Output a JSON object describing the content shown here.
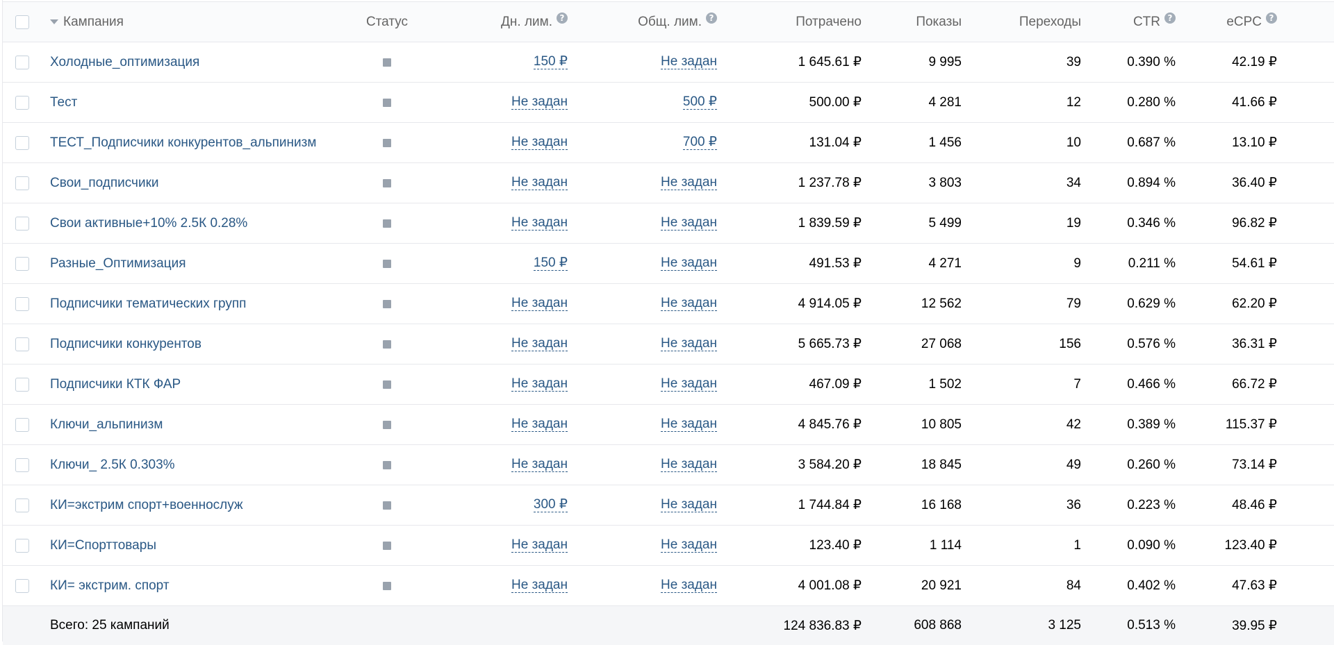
{
  "header": {
    "campaign": "Кампания",
    "status": "Статус",
    "day_limit": "Дн. лим.",
    "total_limit": "Общ. лим.",
    "spent": "Потрачено",
    "shows": "Показы",
    "clicks": "Переходы",
    "ctr": "CTR",
    "ecpc": "eCPC",
    "help_glyph": "?"
  },
  "rows": [
    {
      "name": "Холодные_оптимизация",
      "day": "150 ₽",
      "total": "Не задан",
      "spent": "1 645.61 ₽",
      "shows": "9 995",
      "clicks": "39",
      "ctr": "0.390 %",
      "ecpc": "42.19 ₽"
    },
    {
      "name": "Тест",
      "day": "Не задан",
      "total": "500 ₽",
      "spent": "500.00 ₽",
      "shows": "4 281",
      "clicks": "12",
      "ctr": "0.280 %",
      "ecpc": "41.66 ₽"
    },
    {
      "name": "ТЕСТ_Подписчики конкурентов_альпинизм",
      "day": "Не задан",
      "total": "700 ₽",
      "spent": "131.04 ₽",
      "shows": "1 456",
      "clicks": "10",
      "ctr": "0.687 %",
      "ecpc": "13.10 ₽"
    },
    {
      "name": "Свои_подписчики",
      "day": "Не задан",
      "total": "Не задан",
      "spent": "1 237.78 ₽",
      "shows": "3 803",
      "clicks": "34",
      "ctr": "0.894 %",
      "ecpc": "36.40 ₽"
    },
    {
      "name": "Свои активные+10% 2.5К 0.28%",
      "day": "Не задан",
      "total": "Не задан",
      "spent": "1 839.59 ₽",
      "shows": "5 499",
      "clicks": "19",
      "ctr": "0.346 %",
      "ecpc": "96.82 ₽"
    },
    {
      "name": "Разные_Оптимизация",
      "day": "150 ₽",
      "total": "Не задан",
      "spent": "491.53 ₽",
      "shows": "4 271",
      "clicks": "9",
      "ctr": "0.211 %",
      "ecpc": "54.61 ₽"
    },
    {
      "name": "Подписчики тематических групп",
      "day": "Не задан",
      "total": "Не задан",
      "spent": "4 914.05 ₽",
      "shows": "12 562",
      "clicks": "79",
      "ctr": "0.629 %",
      "ecpc": "62.20 ₽"
    },
    {
      "name": "Подписчики конкурентов",
      "day": "Не задан",
      "total": "Не задан",
      "spent": "5 665.73 ₽",
      "shows": "27 068",
      "clicks": "156",
      "ctr": "0.576 %",
      "ecpc": "36.31 ₽"
    },
    {
      "name": "Подписчики КТК ФАР",
      "day": "Не задан",
      "total": "Не задан",
      "spent": "467.09 ₽",
      "shows": "1 502",
      "clicks": "7",
      "ctr": "0.466 %",
      "ecpc": "66.72 ₽"
    },
    {
      "name": "Ключи_альпинизм",
      "day": "Не задан",
      "total": "Не задан",
      "spent": "4 845.76 ₽",
      "shows": "10 805",
      "clicks": "42",
      "ctr": "0.389 %",
      "ecpc": "115.37 ₽"
    },
    {
      "name": "Ключи_ 2.5К 0.303%",
      "day": "Не задан",
      "total": "Не задан",
      "spent": "3 584.20 ₽",
      "shows": "18 845",
      "clicks": "49",
      "ctr": "0.260 %",
      "ecpc": "73.14 ₽"
    },
    {
      "name": "КИ=экстрим спорт+военнослуж",
      "day": "300 ₽",
      "total": "Не задан",
      "spent": "1 744.84 ₽",
      "shows": "16 168",
      "clicks": "36",
      "ctr": "0.223 %",
      "ecpc": "48.46 ₽"
    },
    {
      "name": "КИ=Спорттовары",
      "day": "Не задан",
      "total": "Не задан",
      "spent": "123.40 ₽",
      "shows": "1 114",
      "clicks": "1",
      "ctr": "0.090 %",
      "ecpc": "123.40 ₽"
    },
    {
      "name": "КИ= экстрим. спорт",
      "day": "Не задан",
      "total": "Не задан",
      "spent": "4 001.08 ₽",
      "shows": "20 921",
      "clicks": "84",
      "ctr": "0.402 %",
      "ecpc": "47.63 ₽"
    }
  ],
  "footer": {
    "label": "Всего: 25 кампаний",
    "spent": "124 836.83 ₽",
    "shows": "608 868",
    "clicks": "3 125",
    "ctr": "0.513 %",
    "ecpc": "39.95 ₽"
  },
  "icons": {
    "sort": "sort-down-icon",
    "help": "question-circle-icon",
    "status": "status-stopped-icon"
  },
  "colors": {
    "link": "#2a5885",
    "header_text": "#656565",
    "status_icon": "#99a2ad",
    "footer_bg": "#f5f6f8"
  }
}
